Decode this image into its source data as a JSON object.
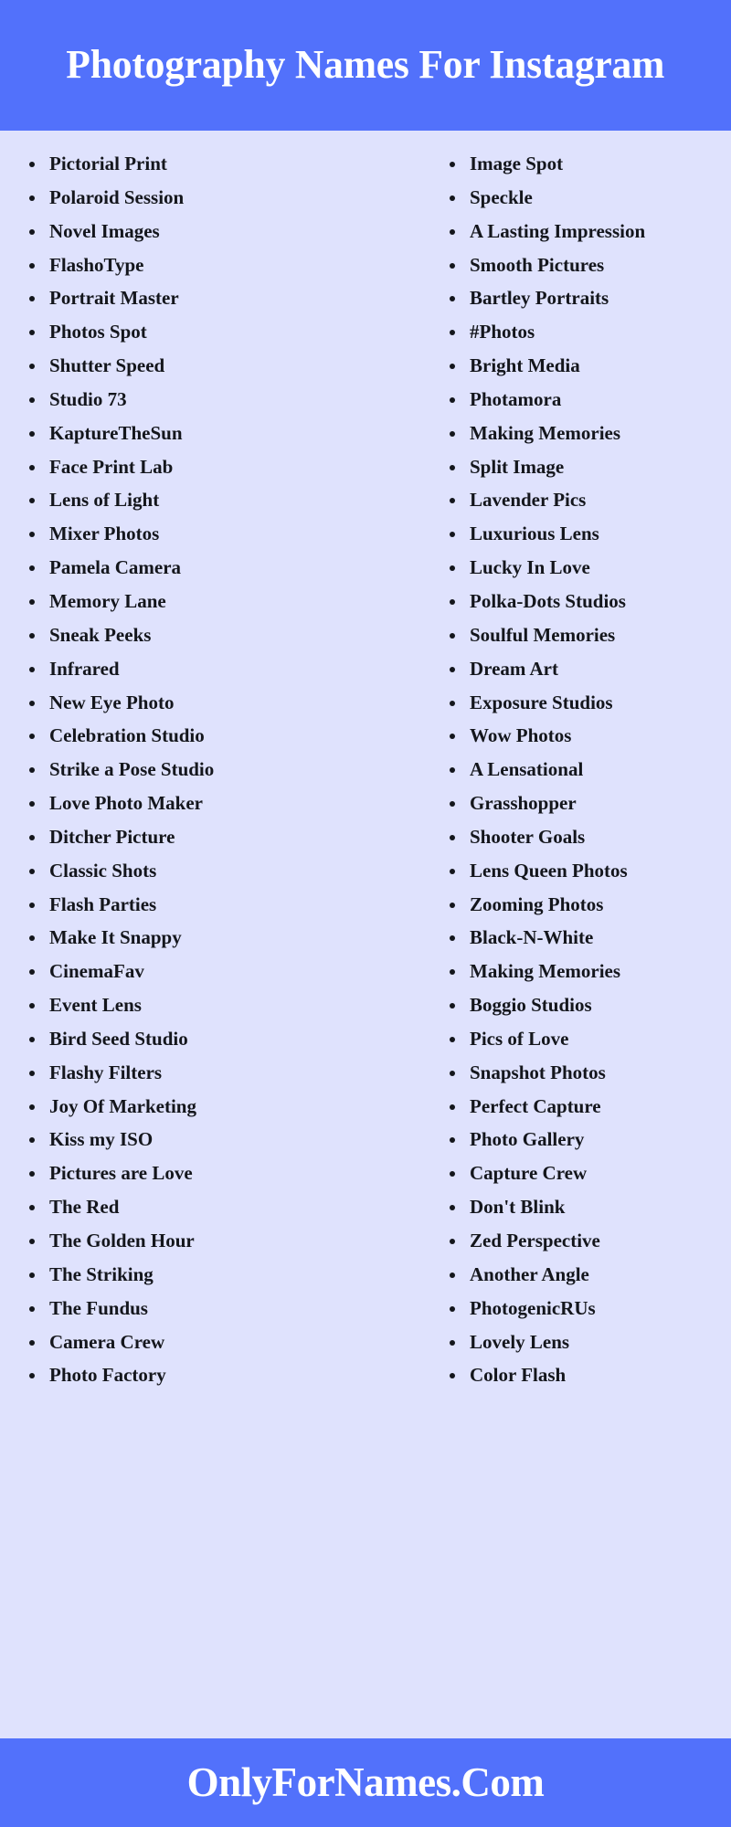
{
  "header": {
    "title": "Photography Names For Instagram",
    "background_color": "#5271fb",
    "text_color": "#ffffff"
  },
  "page": {
    "background_color": "#dfe2fd",
    "text_color": "#14161c"
  },
  "footer": {
    "site_name": "OnlyForNames.Com",
    "background_color": "#5271fb",
    "text_color": "#ffffff"
  },
  "list": {
    "left_column": [
      "Pictorial Print",
      "Polaroid Session",
      "Novel Images",
      "FlashoType",
      "Portrait Master",
      "Photos Spot",
      "Shutter Speed",
      "Studio 73",
      "KaptureTheSun",
      "Face Print Lab",
      "Lens of Light",
      "Mixer Photos",
      "Pamela Camera",
      "Memory Lane",
      "Sneak Peeks",
      "Infrared",
      "New Eye Photo",
      "Celebration Studio",
      "Strike a Pose Studio",
      "Love Photo Maker",
      "Ditcher Picture",
      "Classic Shots",
      "Flash Parties",
      "Make It Snappy",
      "CinemaFav",
      "Event Lens",
      "Bird Seed Studio",
      "Flashy Filters",
      "Joy Of Marketing",
      "Kiss my ISO",
      "Pictures are Love",
      "The Red",
      "The Golden Hour",
      "The Striking",
      "The Fundus",
      "Camera Crew",
      "Photo Factory"
    ],
    "right_column": [
      "Image Spot",
      "Speckle",
      "A Lasting Impression",
      "Smooth Pictures",
      "Bartley Portraits",
      "#Photos",
      "Bright Media",
      "Photamora",
      "Making Memories",
      "Split Image",
      "Lavender Pics",
      "Luxurious Lens",
      "Lucky In Love",
      "Polka-Dots Studios",
      "Soulful Memories",
      "Dream Art",
      "Exposure Studios",
      "Wow Photos",
      "A Lensational",
      "Grasshopper",
      "Shooter Goals",
      "Lens Queen Photos",
      "Zooming Photos",
      "Black-N-White",
      "Making Memories",
      "Boggio Studios",
      "Pics of Love",
      "Snapshot Photos",
      "Perfect Capture",
      "Photo Gallery",
      "Capture Crew",
      "Don't Blink",
      "Zed Perspective",
      "Another Angle",
      "PhotogenicRUs",
      "Lovely Lens",
      "Color Flash"
    ]
  }
}
